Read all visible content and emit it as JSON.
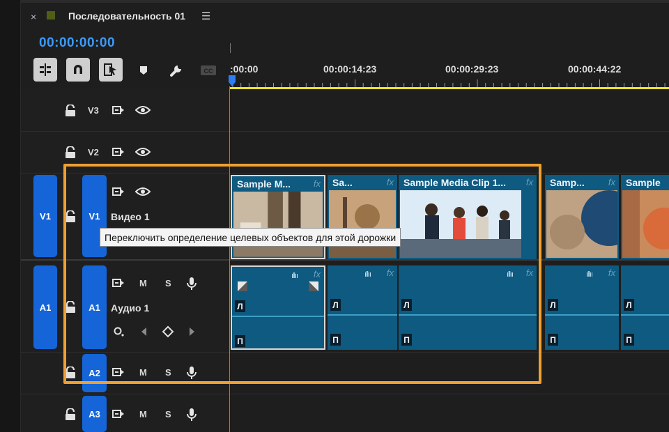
{
  "panel": {
    "close_glyph": "×",
    "sequence_title": "Последовательность 01",
    "menu_glyph": "☰",
    "timecode": "00:00:00:00"
  },
  "toolbar": {
    "tools": [
      {
        "name": "insert-overwrite-toggle-icon",
        "state": "active"
      },
      {
        "name": "snap-magnet-icon",
        "state": "active"
      },
      {
        "name": "linked-selection-icon",
        "state": "active"
      },
      {
        "name": "add-marker-icon",
        "state": "normal"
      },
      {
        "name": "timeline-settings-wrench-icon",
        "state": "normal"
      },
      {
        "name": "captions-cc-icon",
        "state": "disabled"
      }
    ]
  },
  "ruler": {
    "labels": [
      ":00:00",
      "00:00:14:23",
      "00:00:29:23",
      "00:00:44:22"
    ]
  },
  "tracks": {
    "video": [
      {
        "id": "V3",
        "name": ""
      },
      {
        "id": "V2",
        "name": ""
      },
      {
        "id": "V1",
        "source": "V1",
        "name": "Видео 1"
      }
    ],
    "audio": [
      {
        "id": "A1",
        "source": "A1",
        "name": "Аудио 1",
        "mute": "M",
        "solo": "S"
      },
      {
        "id": "A2",
        "mute": "M",
        "solo": "S"
      },
      {
        "id": "A3",
        "mute": "M",
        "solo": "S"
      }
    ]
  },
  "video_clips": [
    {
      "title": "Sample M...",
      "fx": "fx"
    },
    {
      "title": "Sa...",
      "fx": "fx"
    },
    {
      "title": "Sample Media Clip 1...",
      "fx": "fx"
    },
    {
      "title": "Samp...",
      "fx": "fx"
    },
    {
      "title": "Sample",
      "fx": "fx"
    }
  ],
  "audio_clips": {
    "fx": "fx",
    "left_channel": "Л",
    "right_channel": "П"
  },
  "tooltip": "Переключить определение целевых объектов для этой дорожки",
  "colors": {
    "accent_blue": "#1565d8",
    "timecode_blue": "#3a9bff",
    "clip_teal": "#0e5a80",
    "work_area_yellow": "#f0e52a",
    "highlight_orange": "#f0a030",
    "sequence_swatch": "#4f5f17"
  }
}
